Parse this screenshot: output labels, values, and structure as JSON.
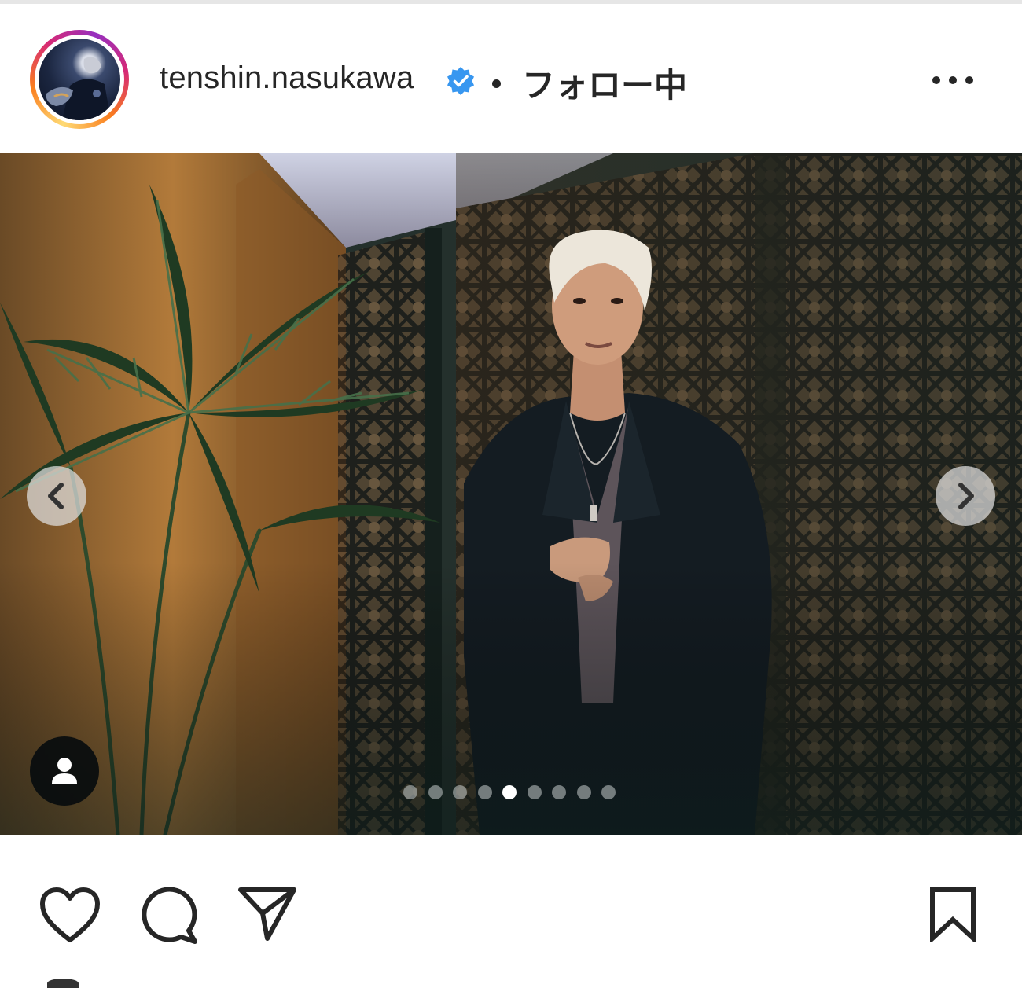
{
  "post": {
    "header": {
      "username": "tenshin.nasukawa",
      "verified": true,
      "verified_icon": "verified-badge-icon",
      "follow_state": "フォロー中",
      "more_icon": "more-options-icon"
    },
    "carousel": {
      "slide_count": 9,
      "active_slide": 5,
      "prev_icon": "chevron-left-icon",
      "next_icon": "chevron-right-icon",
      "tag_icon": "user-tag-icon"
    },
    "actions": {
      "like_icon": "heart-icon",
      "comment_icon": "comment-icon",
      "share_icon": "send-icon",
      "save_icon": "bookmark-icon"
    }
  },
  "colors": {
    "text": "#262626",
    "verified": "#3897f0",
    "ring_gradient": [
      "#feda75",
      "#fa7e1e",
      "#d62976",
      "#962fbf"
    ]
  }
}
